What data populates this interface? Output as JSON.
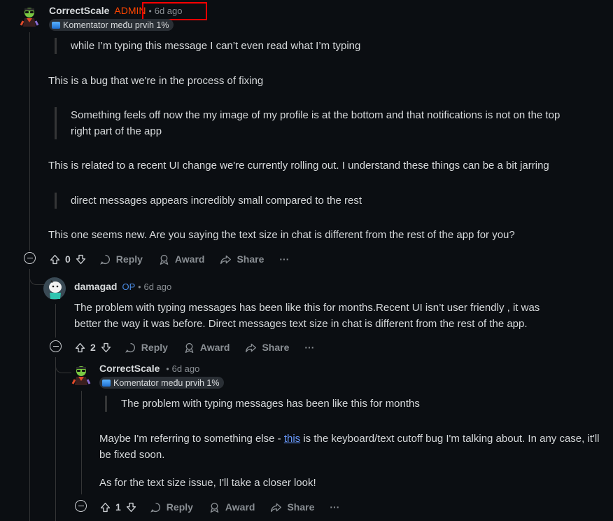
{
  "comments": [
    {
      "username": "CorrectScale",
      "role_badge": "ADMIN",
      "time": "6d ago",
      "flair": "Komentator među prvih 1%",
      "body": [
        {
          "type": "quote",
          "text": "while I’m typing this message I can’t even read what I’m typing"
        },
        {
          "type": "text",
          "text": "This is a bug that we're in the process of fixing"
        },
        {
          "type": "quote",
          "text": "Something feels off now the my image of my profile is at the bottom and that notifications is not on the top right part of the app"
        },
        {
          "type": "text",
          "text": "This is related to a recent UI change we're currently rolling out. I understand these things can be a bit jarring"
        },
        {
          "type": "quote",
          "text": "direct messages appears incredibly small compared to the rest"
        },
        {
          "type": "text",
          "text": "This one seems new. Are you saying the text size in chat is different from the rest of the app for you?"
        }
      ],
      "votes": "0"
    },
    {
      "username": "damagad",
      "role_badge": "OP",
      "time": "6d ago",
      "body": [
        {
          "type": "text",
          "text": "The problem with typing messages has been like this for months.Recent UI isn’t user friendly , it was better the way it was before. Direct messages text size in chat is different from the rest of the app."
        }
      ],
      "votes": "2"
    },
    {
      "username": "CorrectScale",
      "time": "6d ago",
      "flair": "Komentator među prvih 1%",
      "body": [
        {
          "type": "quote",
          "text": "The problem with typing messages has been like this for months"
        },
        {
          "type": "link_text",
          "before": "Maybe I'm referring to something else - ",
          "link": "this",
          "after": " is the keyboard/text cutoff bug I'm talking about. In any case, it'll be fixed soon."
        },
        {
          "type": "text",
          "text": "As for the text size issue, I'll take a closer look!"
        }
      ],
      "votes": "1"
    }
  ],
  "actions": {
    "reply": "Reply",
    "award": "Award",
    "share": "Share",
    "more": "···"
  },
  "icons": [
    "upvote-icon",
    "downvote-icon",
    "reply-icon",
    "award-icon",
    "share-icon",
    "collapse-icon",
    "more-icon"
  ],
  "colors": {
    "background": "#0b0e12",
    "admin": "#ff4500",
    "op": "#4a8ae0",
    "link": "#6a9bff",
    "highlight": "#ff0000"
  }
}
